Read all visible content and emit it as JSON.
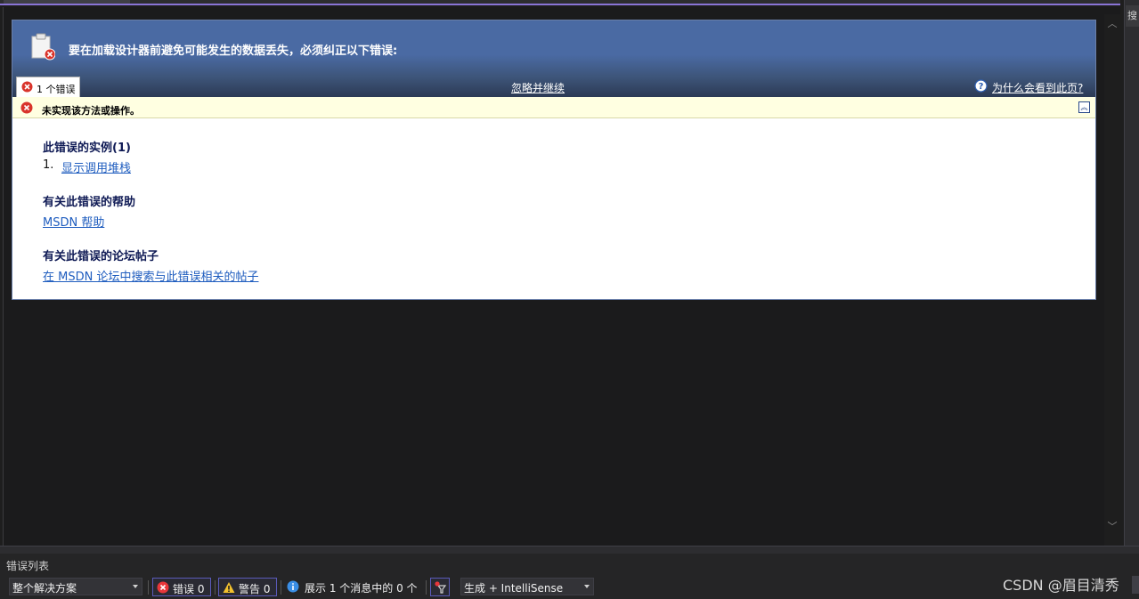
{
  "designer_error": {
    "title": "要在加载设计器前避免可能发生的数据丢失，必须纠正以下错误:",
    "error_tab_label": "1 个错误",
    "ignore_continue": "忽略并继续",
    "why_link": "为什么会看到此页?",
    "error_message": "未实现该方法或操作。",
    "instances_title": "此错误的实例(1)",
    "instance_number": "1.",
    "instance_link": "显示调用堆栈",
    "help_title": "有关此错误的帮助",
    "help_link": "MSDN 帮助",
    "forum_title": "有关此错误的论坛帖子",
    "forum_link": "在 MSDN 论坛中搜索与此错误相关的帖子"
  },
  "error_list": {
    "panel_title": "错误列表",
    "scope_value": "整个解决方案",
    "errors_label": "错误 0",
    "warnings_label": "警告 0",
    "messages_label": "展示 1 个消息中的 0 个",
    "build_value": "生成 + IntelliSense"
  },
  "right_pane_tab": "搜",
  "watermark": "CSDN @眉目清秀",
  "colors": {
    "header_blue": "#4a6aa3",
    "error_red": "#d9342b",
    "link_blue": "#1f5dbf",
    "info_bar": "#ffffe1"
  }
}
